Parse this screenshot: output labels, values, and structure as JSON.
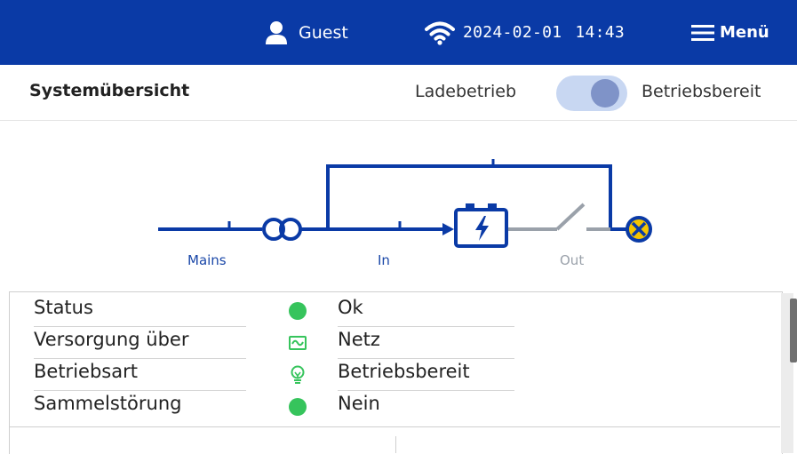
{
  "header": {
    "user_name": "Guest",
    "date": "2024-02-01",
    "time": "14:43",
    "menu_label": "Menü"
  },
  "titlebar": {
    "title": "Systemübersicht",
    "mode_left": "Ladebetrieb",
    "mode_right": "Betriebsbereit",
    "toggle_on": true
  },
  "diagram": {
    "label_mains": "Mains",
    "label_in": "In",
    "label_out": "Out"
  },
  "status": {
    "rows": [
      {
        "label": "Status",
        "icon": "green-dot",
        "value": "Ok"
      },
      {
        "label": "Versorgung über",
        "icon": "mains-sine-icon",
        "value": "Netz"
      },
      {
        "label": "Betriebsart",
        "icon": "lightbulb-icon",
        "value": "Betriebsbereit"
      },
      {
        "label": "Sammelstörung",
        "icon": "green-dot",
        "value": "Nein"
      }
    ]
  },
  "colors": {
    "brand_blue": "#0a3aa6",
    "ok_green": "#36c45c",
    "lamp_yellow": "#f5c400",
    "inactive_gray": "#9aa1aa"
  }
}
